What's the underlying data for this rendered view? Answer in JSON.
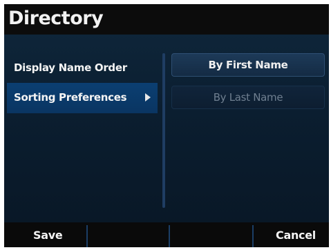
{
  "header": {
    "title": "Directory"
  },
  "menu": {
    "items": [
      {
        "label": "Display Name Order",
        "selected": false
      },
      {
        "label": "Sorting Preferences",
        "selected": true,
        "icon": "right-triangle-icon"
      }
    ]
  },
  "options": [
    {
      "label": "By First Name",
      "active": true
    },
    {
      "label": "By Last Name",
      "active": false
    }
  ],
  "softkeys": {
    "left": "Save",
    "right": "Cancel"
  },
  "colors": {
    "background": "#000000",
    "content_bg": "#0e2539",
    "selected_item": "#0b3f72",
    "divider": "#1b3e66",
    "text": "#f4f4f4",
    "dim_text": "#6f7f90"
  }
}
